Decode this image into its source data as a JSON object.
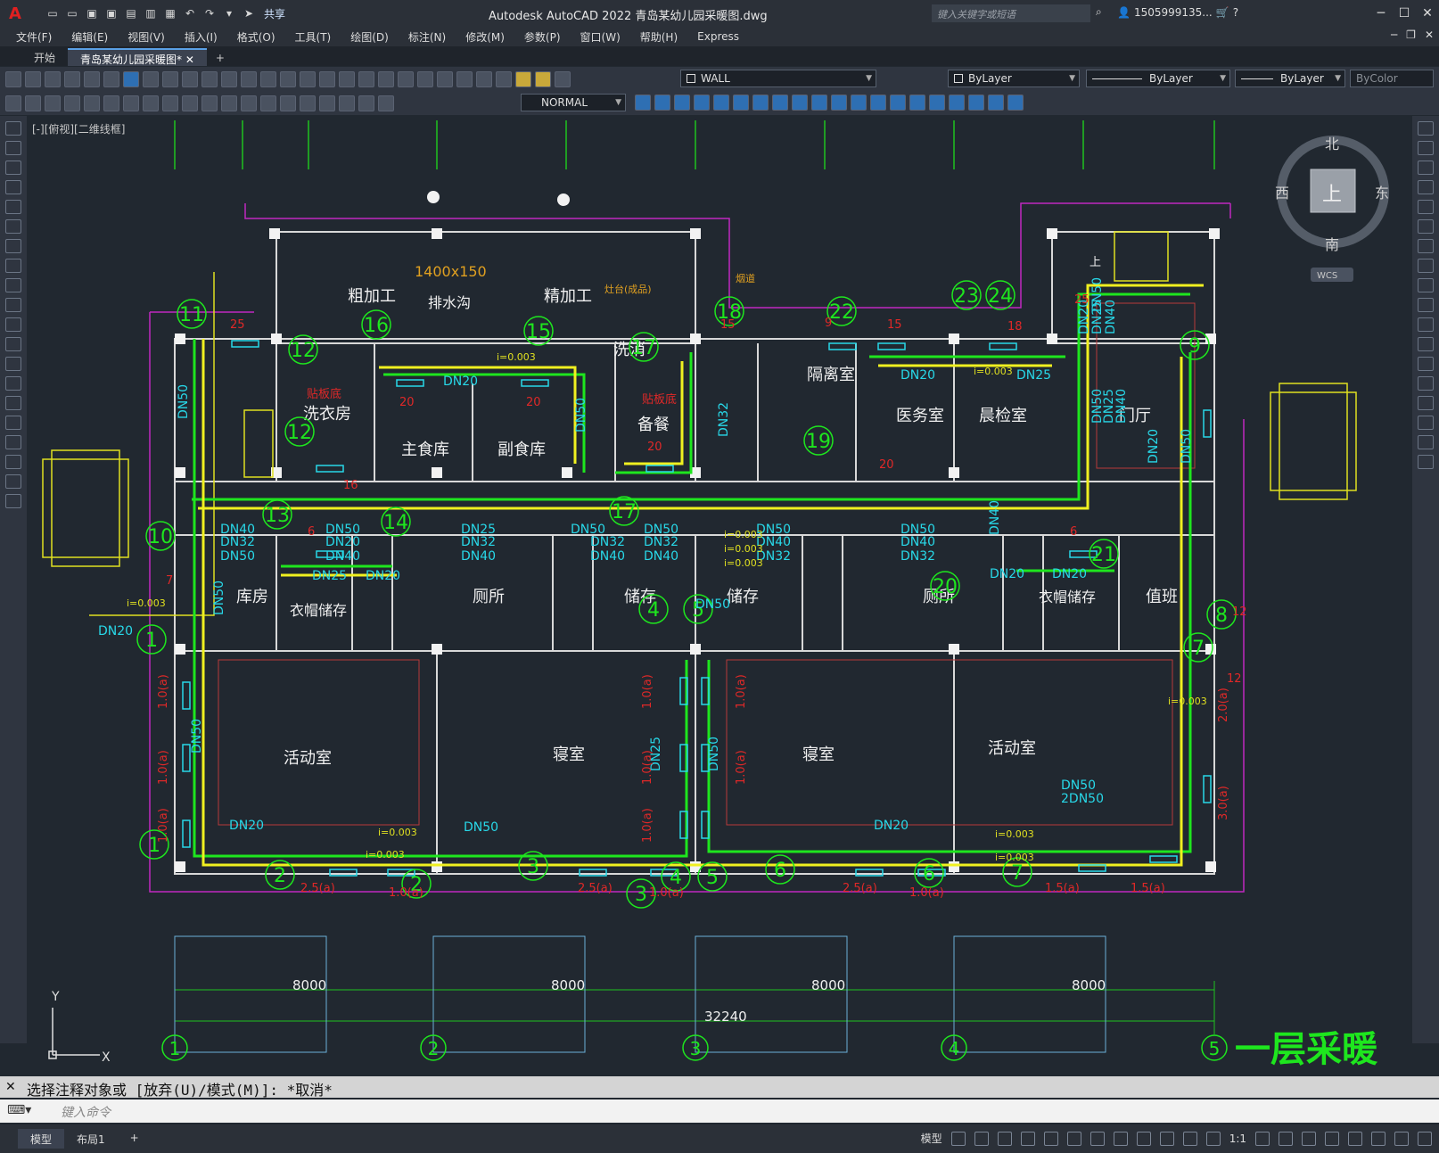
{
  "app": {
    "logo": "A",
    "title": "Autodesk AutoCAD 2022    青岛某幼儿园采暖图.dwg",
    "share": "共享"
  },
  "search": {
    "placeholder": "键入关键字或短语"
  },
  "user": {
    "name": "1505999135...",
    "help": "?"
  },
  "menu": [
    "文件(F)",
    "编辑(E)",
    "视图(V)",
    "插入(I)",
    "格式(O)",
    "工具(T)",
    "绘图(D)",
    "标注(N)",
    "修改(M)",
    "参数(P)",
    "窗口(W)",
    "帮助(H)",
    "Express"
  ],
  "tabs": [
    {
      "label": "开始"
    },
    {
      "label": "青岛某幼儿园采暖图*"
    }
  ],
  "toolbar": {
    "layer": "WALL",
    "color": "ByLayer",
    "linetype": "ByLayer",
    "lineweight": "ByLayer",
    "plotstyle": "ByColor",
    "textstyle": "NORMAL"
  },
  "viewport": {
    "label": "[-][俯视][二维线框]"
  },
  "viewcube": {
    "north": "北",
    "south": "南",
    "east": "东",
    "west": "西",
    "top": "上",
    "wcs": "WCS"
  },
  "drawing": {
    "rooms": [
      {
        "name": "粗加工"
      },
      {
        "name": "排水沟"
      },
      {
        "name": "精加工"
      },
      {
        "name": "洗衣房"
      },
      {
        "name": "主食库"
      },
      {
        "name": "副食库"
      },
      {
        "name": "洗消"
      },
      {
        "name": "备餐"
      },
      {
        "name": "隔离室"
      },
      {
        "name": "医务室"
      },
      {
        "name": "晨检室"
      },
      {
        "name": "门厅"
      },
      {
        "name": "库房"
      },
      {
        "name": "衣帽储存"
      },
      {
        "name": "厕所"
      },
      {
        "name": "储存"
      },
      {
        "name": "储存"
      },
      {
        "name": "厕所"
      },
      {
        "name": "衣帽储存"
      },
      {
        "name": "值班"
      },
      {
        "name": "活动室"
      },
      {
        "name": "寝室"
      },
      {
        "name": "寝室"
      },
      {
        "name": "活动室"
      }
    ],
    "circle_tags": [
      "11",
      "12",
      "16",
      "15",
      "17",
      "18",
      "22",
      "23",
      "24",
      "9",
      "12",
      "19",
      "13",
      "14",
      "17",
      "21",
      "20",
      "10",
      "1",
      "4",
      "5",
      "8",
      "7",
      "1",
      "2",
      "3",
      "4",
      "5",
      "6",
      "7",
      "2",
      "3",
      "6"
    ],
    "pipe_labels": [
      "DN20",
      "DN20",
      "DN25",
      "DN50",
      "DN20",
      "DN25",
      "DN40",
      "DN50",
      "DN25",
      "DN40",
      "DN50",
      "DN32",
      "DN40",
      "DN50",
      "DN32",
      "DN40",
      "DN50",
      "DN40",
      "DN32",
      "DN50",
      "DN40",
      "DN32",
      "DN50",
      "DN20",
      "DN20",
      "DN20",
      "DN50",
      "DN40",
      "DN32",
      "DN50",
      "DN50",
      "DN20",
      "DN40",
      "DN25",
      "DN32",
      "DN40",
      "DN25",
      "DN20",
      "DN50",
      "DN50",
      "DN40",
      "DN32",
      "DN50",
      "DN50",
      "DN25",
      "DN50",
      "DN20",
      "DN50",
      "2DN50",
      "DN20",
      "DN20",
      "DN50"
    ],
    "slope": "i=0.003",
    "dims": {
      "bay1": "8000",
      "bay2": "8000",
      "bay3": "8000",
      "bay4": "8000",
      "total": "32240"
    },
    "axis_tags": [
      "1",
      "2",
      "3",
      "4",
      "5"
    ],
    "heights": [
      "1.0(a)",
      "1.0(a)",
      "1.0(a)",
      "1.0(a)",
      "1.0(a)",
      "1.0(a)",
      "1.0(a)",
      "1.0(a)",
      "2.5(a)",
      "1.0(a)",
      "2.5(a)",
      "1.0(a)",
      "2.5(a)",
      "1.0(a)",
      "1.5(a)",
      "1.5(a)",
      "2.0(a)",
      "3.0(a)"
    ],
    "red_nums": [
      "25",
      "20",
      "20",
      "20",
      "20",
      "15",
      "9",
      "15",
      "18",
      "25",
      "16",
      "6",
      "6",
      "7",
      "12",
      "12"
    ],
    "notes": [
      "贴板底",
      "贴板底",
      "烟道",
      "灶台(成品)",
      "1400x150",
      "上"
    ],
    "sheet_title": "一层采暖"
  },
  "command": {
    "history": "选择注释对象或 [放弃(U)/模式(M)]: *取消*",
    "placeholder": "键入命令"
  },
  "status": {
    "tabs": [
      {
        "label": "模型"
      },
      {
        "label": "布局1"
      }
    ],
    "model": "模型",
    "scale": "1:1"
  }
}
